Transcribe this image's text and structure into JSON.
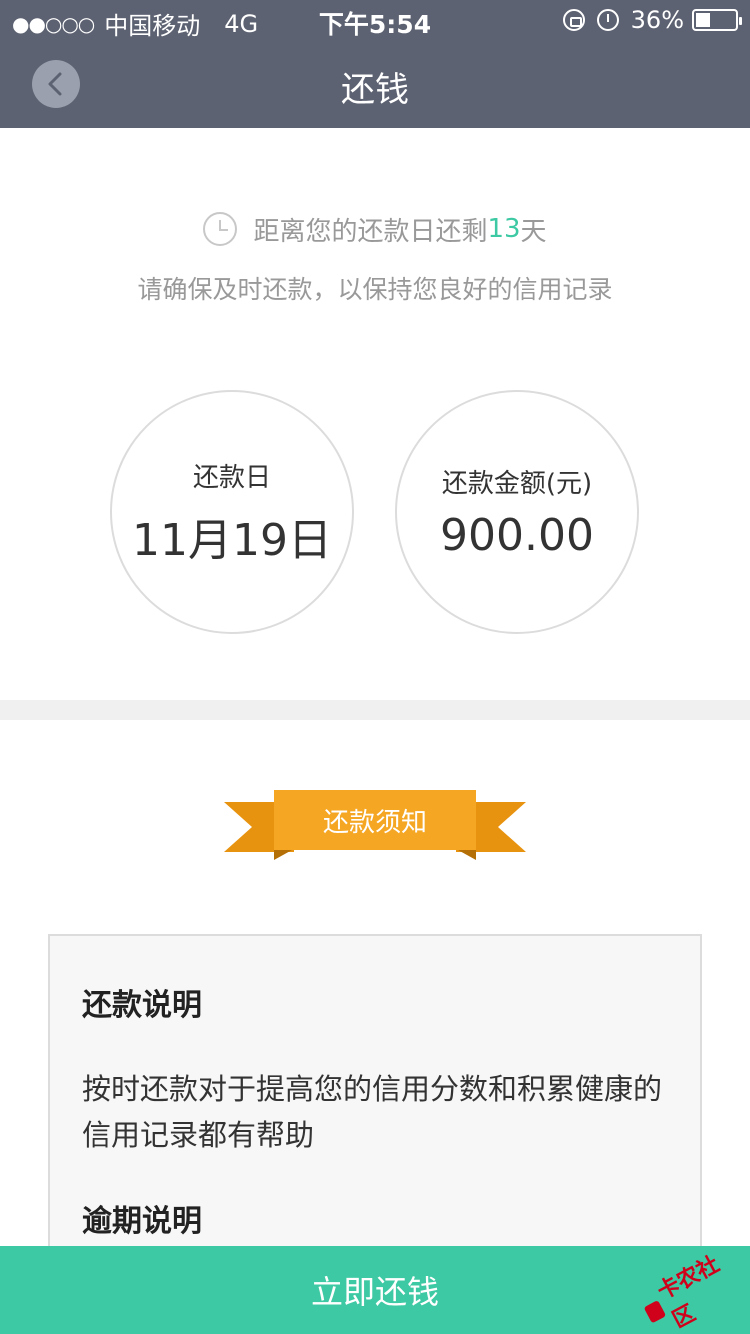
{
  "status_bar": {
    "signal": "●●○○○",
    "carrier": "中国移动",
    "network": "4G",
    "time": "下午5:54",
    "battery_percent": "36%",
    "battery_level": 0.36
  },
  "nav": {
    "title": "还钱"
  },
  "countdown": {
    "prefix": "距离您的还款日还剩",
    "days": "13",
    "suffix": "天",
    "reminder": "请确保及时还款，以保持您良好的信用记录"
  },
  "due_date": {
    "label": "还款日",
    "value": "11月19日"
  },
  "amount": {
    "label": "还款金额(元)",
    "value": "900.00"
  },
  "ribbon": {
    "label": "还款须知"
  },
  "notice": {
    "section1_title": "还款说明",
    "section1_body": "按时还款对于提高您的信用分数和积累健康的信用记录都有帮助",
    "section2_title": "逾期说明"
  },
  "pay_button": {
    "label": "立即还钱"
  },
  "colors": {
    "header_bg": "#5d6272",
    "accent_green": "#3dc9a3",
    "ribbon_orange": "#f5a623"
  }
}
